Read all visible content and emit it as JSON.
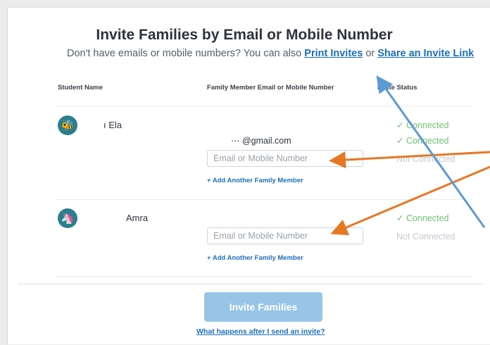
{
  "header": {
    "title": "Invite Families by Email or Mobile Number",
    "subtitle_prefix": "Don't have emails or mobile numbers? You can also",
    "print_invites_label": "Print Invites",
    "subtitle_or": "or",
    "share_link_label": "Share an Invite Link"
  },
  "table": {
    "col_student": "Student Name",
    "col_contact": "Family Member Email or Mobile Number",
    "col_status": "Invite Status"
  },
  "students": [
    {
      "name": "ı Ela",
      "avatar_icon": "bee-icon",
      "avatar_glyph": "🐝",
      "existing_contact": "⋯ @gmail.com",
      "input_placeholder": "Email or Mobile Number",
      "add_label": "+ Add Another Family Member",
      "statuses": [
        "✓ Connected",
        "✓ Connected",
        "Not Connected"
      ]
    },
    {
      "name": "Amra",
      "avatar_icon": "unicorn-icon",
      "avatar_glyph": "🦄",
      "input_placeholder": "Email or Mobile Number",
      "add_label": "+ Add Another Family Member",
      "statuses": [
        "✓ Connected",
        "Not Connected"
      ]
    }
  ],
  "footer": {
    "invite_button_label": "Invite Families",
    "help_link_label": "What happens after I send an invite?"
  },
  "colors": {
    "link": "#1d6fb8",
    "connected": "#6cc36e",
    "not_connected": "#c4c9cf",
    "button": "#98c5e6",
    "avatar_bg": "#2a7f8f",
    "annotation_orange": "#e87722",
    "annotation_blue": "#5b9bd5"
  }
}
